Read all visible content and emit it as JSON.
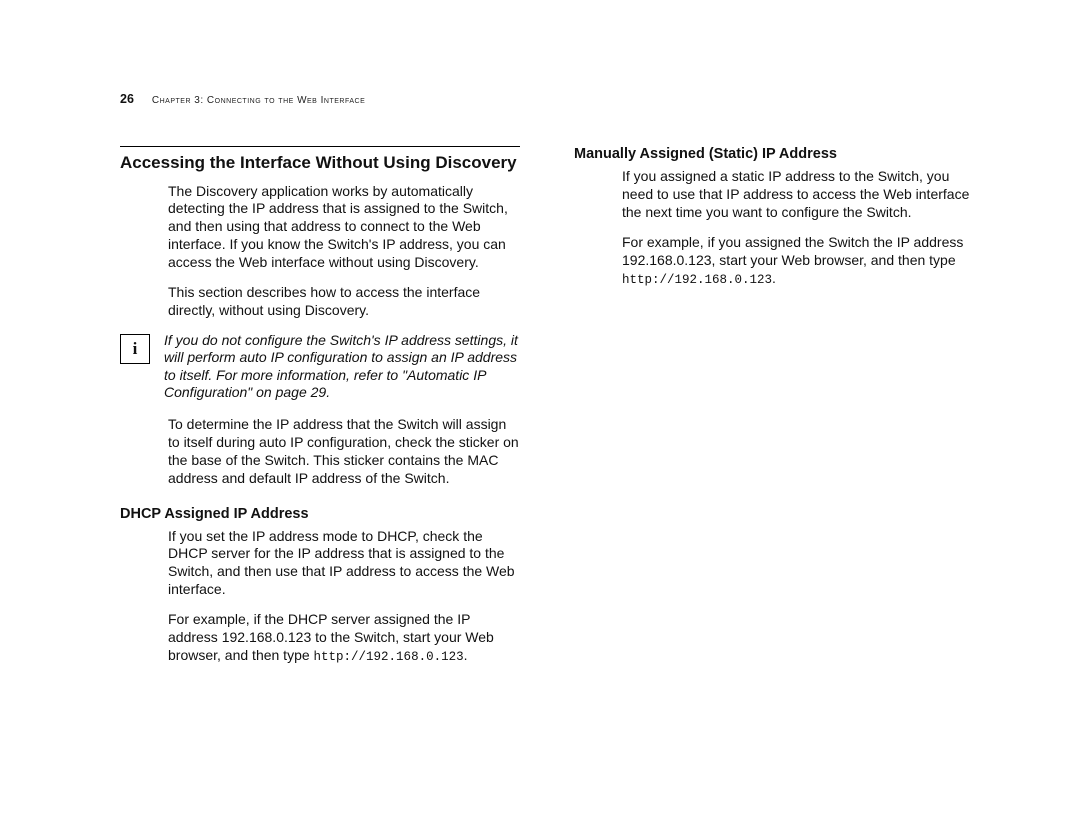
{
  "header": {
    "page_number": "26",
    "chapter_label": "Chapter 3: Connecting to the Web Interface"
  },
  "left": {
    "section_title": "Accessing the Interface Without Using Discovery",
    "p1": "The Discovery application works by automatically detecting the IP address that is assigned to the Switch, and then using that address to connect to the Web interface. If you know the Switch's IP address, you can access the Web interface without using Discovery.",
    "p2": "This section describes how to access the interface directly, without using Discovery.",
    "note_icon": "i",
    "note": "If you do not configure the Switch's IP address settings, it will perform auto IP configuration to assign an IP address to itself. For more information, refer to \"Automatic IP Configuration\" on page 29.",
    "p3": "To determine the IP address that the Switch will assign to itself during auto IP configuration, check the sticker on the base of the Switch. This sticker contains the MAC address and default IP address of the Switch.",
    "dhcp_title": "DHCP Assigned IP Address",
    "dhcp_p1": "If you set the IP address mode to DHCP, check the DHCP server for the IP address that is assigned to the Switch, and then use that IP address to access the Web interface.",
    "dhcp_p2a": "For example, if the DHCP server assigned the IP address 192.168.0.123 to the Switch, start your Web browser, and then type ",
    "dhcp_p2_url": "http://192.168.0.123",
    "dhcp_p2b": "."
  },
  "right": {
    "static_title": "Manually Assigned (Static) IP Address",
    "static_p1": "If you assigned a static IP address to the Switch, you need to use that IP address to access the Web interface the next time you want to configure the Switch.",
    "static_p2a": "For example, if you assigned the Switch the IP address 192.168.0.123, start your Web browser, and then type ",
    "static_p2_url": "http://192.168.0.123",
    "static_p2b": "."
  }
}
